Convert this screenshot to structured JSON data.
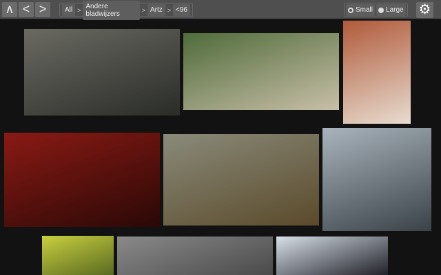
{
  "nav": {
    "up": "∧",
    "back": "<",
    "forward": ">"
  },
  "breadcrumb": {
    "items": [
      "All",
      "Andere bladwijzers",
      "Artz",
      "<96"
    ],
    "separator": ">"
  },
  "size": {
    "small": "Small",
    "large": "Large",
    "selected": "Small"
  },
  "thumbnails": [
    {
      "subject": "misty-forest",
      "colors": [
        "#6a6a62",
        "#2a2c28"
      ]
    },
    {
      "subject": "picnic-scene",
      "colors": [
        "#4f6b3a",
        "#c8bfa8"
      ]
    },
    {
      "subject": "redhead-portrait",
      "colors": [
        "#b05a3a",
        "#e8dcd0"
      ]
    },
    {
      "subject": "red-anime-girl",
      "colors": [
        "#8a1a14",
        "#2a0806"
      ]
    },
    {
      "subject": "swamp-sunlight",
      "colors": [
        "#8a8a7a",
        "#5a4a2a"
      ]
    },
    {
      "subject": "pale-figure",
      "colors": [
        "#aab4bc",
        "#3a4248"
      ]
    },
    {
      "subject": "yellow-horned-girl",
      "colors": [
        "#c8d040",
        "#5a6a20"
      ]
    },
    {
      "subject": "foggy-forest",
      "colors": [
        "#8a8a8a",
        "#4a4a4a"
      ]
    },
    {
      "subject": "anime-group",
      "colors": [
        "#d8e0e8",
        "#202028"
      ]
    }
  ]
}
